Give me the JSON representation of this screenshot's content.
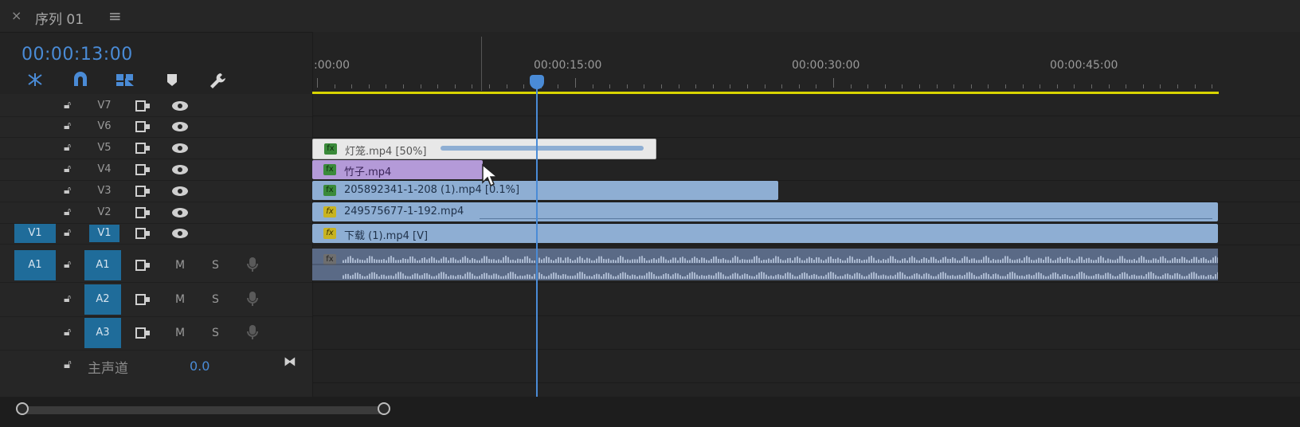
{
  "panel": {
    "close_label": "×",
    "title": "序列 01",
    "menu_label": "≡"
  },
  "timecode": "00:00:13:00",
  "ruler": {
    "labels": [
      ":00:00",
      "00:00:15:00",
      "00:00:30:00",
      "00:00:45:00"
    ]
  },
  "tracks": {
    "video": [
      {
        "label": "V7",
        "target": false
      },
      {
        "label": "V6",
        "target": false
      },
      {
        "label": "V5",
        "target": false
      },
      {
        "label": "V4",
        "target": false
      },
      {
        "label": "V3",
        "target": false
      },
      {
        "label": "V2",
        "target": false
      },
      {
        "label": "V1",
        "target": true,
        "source": "V1"
      }
    ],
    "audio": [
      {
        "label": "A1",
        "target": true,
        "source": "A1",
        "m": "M",
        "s": "S"
      },
      {
        "label": "A2",
        "target": true,
        "m": "M",
        "s": "S"
      },
      {
        "label": "A3",
        "target": true,
        "m": "M",
        "s": "S"
      }
    ],
    "master": {
      "label": "主声道",
      "value": "0.0"
    }
  },
  "clips": [
    {
      "track": "V5",
      "name": "灯笼.mp4 [50%]",
      "fx": "fx"
    },
    {
      "track": "V4",
      "name": "竹子.mp4",
      "fx": "fx"
    },
    {
      "track": "V3",
      "name": "205892341-1-208 (1).mp4 [0.1%]",
      "fx": "fx"
    },
    {
      "track": "V2",
      "name": "249575677-1-192.mp4",
      "fx": "fx"
    },
    {
      "track": "V1",
      "name": "下载 (1).mp4 [V]",
      "fx": "fx"
    },
    {
      "track": "A1",
      "name": "",
      "fx": "fx"
    }
  ],
  "colors": {
    "accent": "#4a8bd6",
    "ruler_work_area": "#d8d400",
    "clip_blue": "#8eaed3",
    "clip_purple": "#b49ad8",
    "clip_white": "#e8e8e8",
    "target_blue": "#1f6c9a"
  },
  "icons": [
    "close-icon",
    "menu-icon",
    "nest-icon",
    "snap-icon",
    "linked-selection-icon",
    "marker-icon",
    "wrench-icon",
    "lock-icon",
    "sync-lock-icon",
    "eye-icon",
    "mic-icon",
    "collapse-icon",
    "fx-icon"
  ]
}
